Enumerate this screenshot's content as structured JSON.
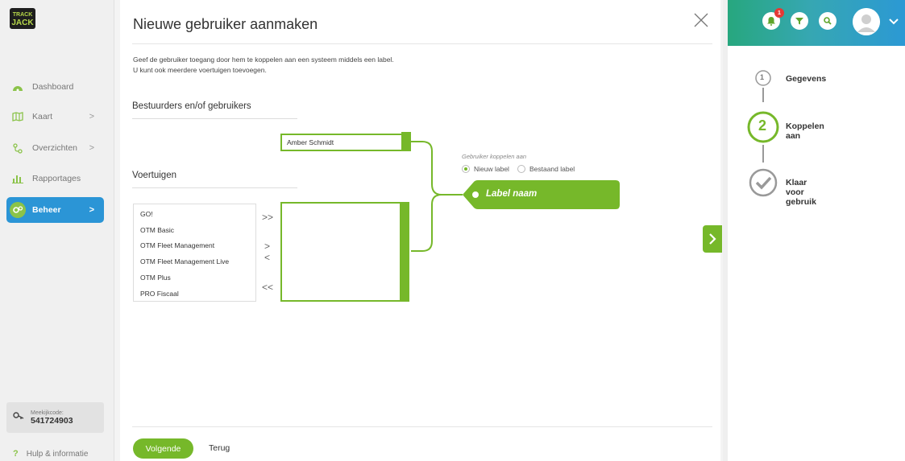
{
  "sidebar": {
    "logo": "TRACK JACK",
    "items": [
      {
        "label": "Dashboard",
        "icon": "dashboard-icon"
      },
      {
        "label": "Kaart",
        "icon": "map-icon"
      },
      {
        "label": "Overzichten",
        "icon": "route-icon"
      },
      {
        "label": "Rapportages",
        "icon": "bar-chart-icon"
      },
      {
        "label": "Beheer",
        "icon": "gears-icon"
      }
    ],
    "meekijk_label": "Meekijkcode:",
    "meekijk_code": "541724903",
    "help": "Hulp & informatie"
  },
  "main": {
    "title": "Nieuwe gebruiker aanmaken",
    "intro_line1": "Geef de gebruiker toegang door hem te koppelen aan een systeem middels een label.",
    "intro_line2": "U kunt ook meerdere voertuigen toevoegen.",
    "section_users": "Bestuurders en/of gebruikers",
    "section_vehicles": "Voertuigen",
    "selected_user": "Amber Schmidt",
    "vehicles": [
      "GO!",
      "OTM Basic",
      "OTM Fleet Management",
      "OTM Fleet Management Live",
      "OTM Plus",
      "PRO Fiscaal"
    ],
    "arrows": {
      "all_right": ">>",
      "right": ">",
      "left": "<",
      "all_left": "<<"
    },
    "link_label": "Gebruiker koppelen aan",
    "radio_new": "Nieuw label",
    "radio_existing": "Bestaand label",
    "label_placeholder": "Label naam",
    "next_button": "Volgende",
    "back_button": "Terug"
  },
  "topbar": {
    "notification_count": "1"
  },
  "steps": [
    {
      "number": "1",
      "label": "Gegevens"
    },
    {
      "number": "2",
      "label": "Koppelen aan"
    },
    {
      "number": "",
      "label": "Klaar voor gebruik"
    }
  ],
  "colors": {
    "accent_green": "#76b82a",
    "active_blue": "#2b95d6"
  }
}
